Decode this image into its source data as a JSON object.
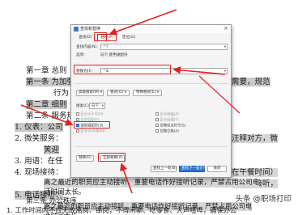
{
  "document": {
    "lines": [
      {
        "t": "第一章  总则"
      },
      {
        "t": "第一条  为加强"
      },
      {
        "t": "需要，规范",
        "right": true
      },
      {
        "t": "行为"
      },
      {
        "t": "第二章  细则"
      },
      {
        "t": "第二条  服务规"
      },
      {
        "t": "1. 仪表：公司"
      },
      {
        "t": "2. 微笑服务："
      },
      {
        "t": "注释对方，微",
        "right": true
      },
      {
        "t": "笑迎"
      },
      {
        "t": "3. 用语：在任"
      },
      {
        "t": "4. 现场接待："
      },
      {
        "t": "在午餐时间）",
        "right": true
      },
      {
        "t": "办公"
      },
      {
        "t": "5. 电话接听："
      },
      {
        "t": "人不能接听，",
        "right": true
      },
      {
        "t": "离之最近的职员应主动接听，重要电话作好接听记录，严禁占用公司电"
      },
      {
        "t": "话时间太长。"
      },
      {
        "t": "第三条  办公秩序"
      },
      {
        "t": "1. 工作时间内不应无故离岗、串岗，不得闲聊、吃零食、大声喧哗，确保办公"
      }
    ]
  },
  "dialog": {
    "title": "查找和替换",
    "close": "×",
    "tabs": [
      "查找(D)",
      "替换(P)",
      "定位(G)"
    ],
    "find_label": "查找内容(N):",
    "find_value": "^?",
    "options_label": "选项:",
    "options_value": "向下,使用通配符",
    "replace_label": "替换为(I):",
    "replace_value": "^&",
    "format_btn": "高级搜索(M) ▾",
    "format2_btn": "格式(O) ▾",
    "special_btn": "特殊格式(E) ▾",
    "search_label": "搜索(C)",
    "search_value": "向下",
    "checks": [
      {
        "label": "区分大小写(H)",
        "on": false,
        "dim": true
      },
      {
        "label": "全字匹配(Y)",
        "on": false,
        "dim": true
      },
      {
        "label": "使用通配符(U)",
        "on": true,
        "dim": false
      },
      {
        "label": "区分全/半角(M)",
        "on": false,
        "dim": true
      },
      {
        "label": "区分前缀(X)",
        "on": false,
        "dim": true
      },
      {
        "label": "区分后缀(T)",
        "on": false,
        "dim": true
      },
      {
        "label": "忽略标点符号(S)",
        "on": false,
        "dim": false
      },
      {
        "label": "忽略空格(A)",
        "on": false,
        "dim": false
      }
    ],
    "replace_btn": "替换(R)",
    "replace_all_btn": "全部替换(A)",
    "find_prev_btn": "查找上一处(B)",
    "find_next_btn": "查找下一处(F)",
    "close_btn": "关闭"
  },
  "watermark": "头条 @职场打印",
  "colors": {
    "accent": "#2f74d0",
    "annotation": "#e02020"
  }
}
